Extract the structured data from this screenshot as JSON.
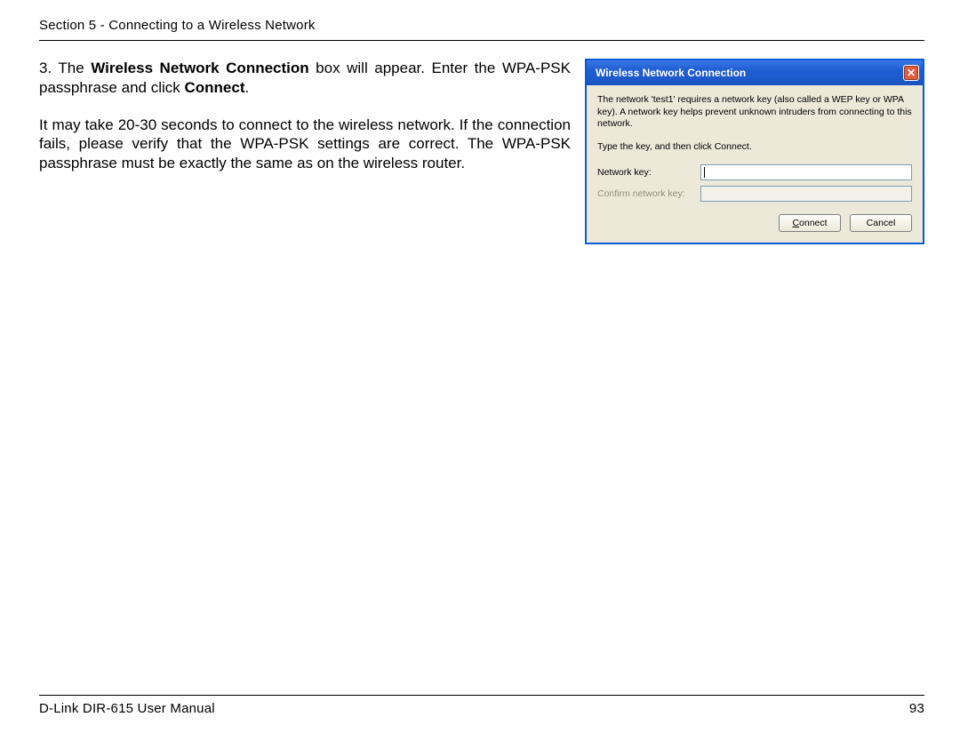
{
  "header": "Section 5 - Connecting to a Wireless Network",
  "step": {
    "num": "3.",
    "pre": "The ",
    "bold1": "Wireless Network Connection",
    "mid": " box will appear. Enter the WPA-PSK passphrase and click ",
    "bold2": "Connect",
    "post": "."
  },
  "para": "It may take 20-30 seconds to connect to the wireless network. If the connection fails, please verify that the WPA-PSK settings are correct. The WPA-PSK passphrase must be exactly the same as on the wireless router.",
  "dialog": {
    "title": "Wireless Network Connection",
    "close": "✕",
    "msg": "The network 'test1' requires a network key (also called a WEP key or WPA key). A network key helps prevent unknown intruders from connecting to this network.",
    "instr": "Type the key, and then click Connect.",
    "label1": "Network key:",
    "label2": "Confirm network key:",
    "btn_connect_u": "C",
    "btn_connect_rest": "onnect",
    "btn_cancel": "Cancel"
  },
  "footer": {
    "left": "D-Link DIR-615 User Manual",
    "right": "93"
  }
}
